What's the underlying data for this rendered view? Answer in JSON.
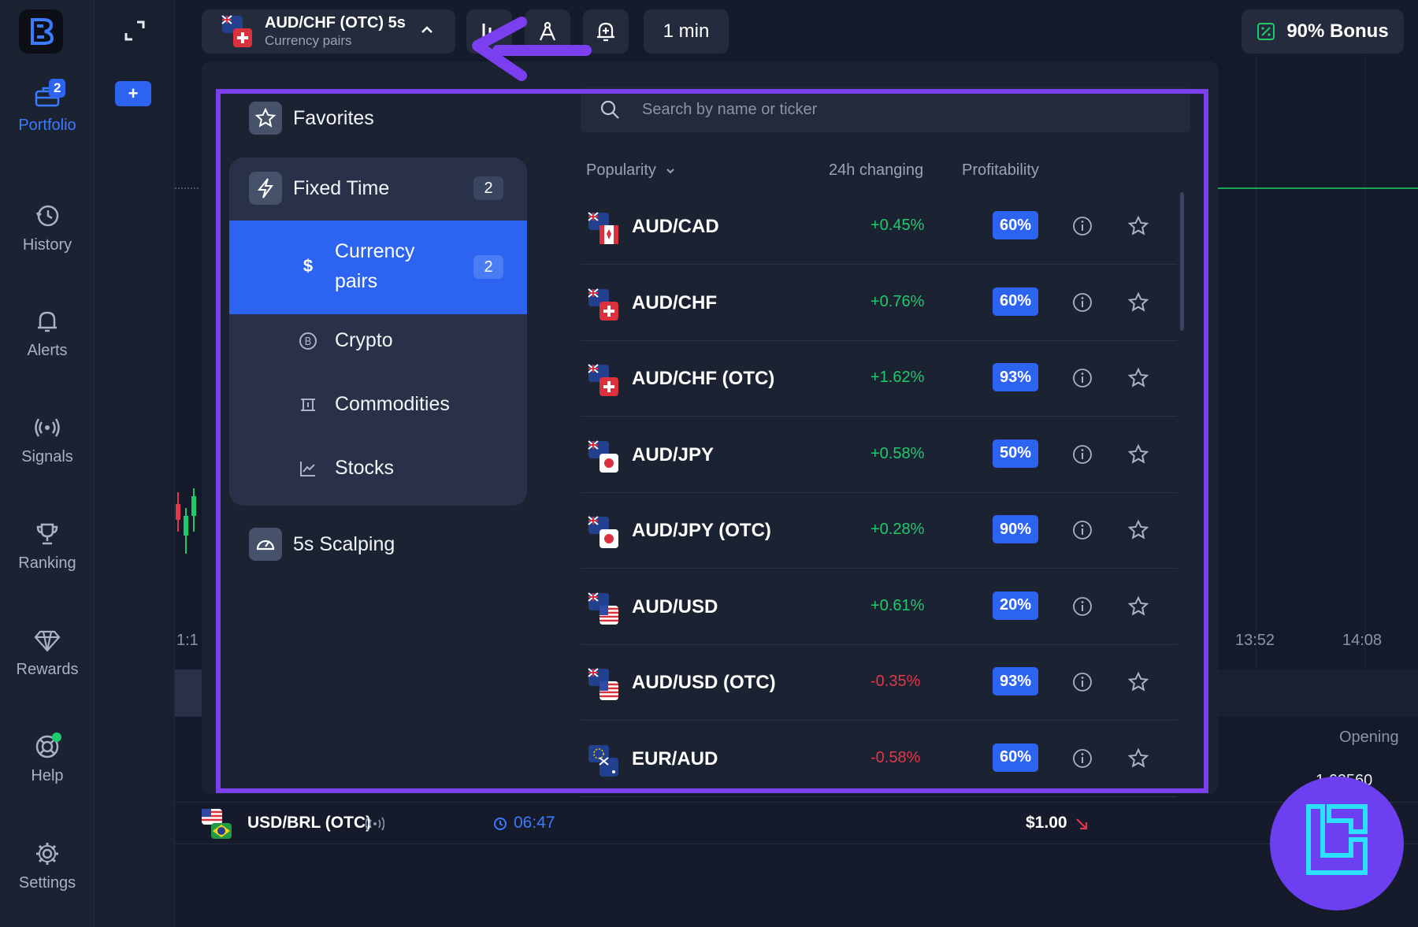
{
  "rail": {
    "items": [
      {
        "label": "Portfolio",
        "badge": "2"
      },
      {
        "label": "History"
      },
      {
        "label": "Alerts"
      },
      {
        "label": "Signals"
      },
      {
        "label": "Ranking"
      },
      {
        "label": "Rewards"
      },
      {
        "label": "Help"
      },
      {
        "label": "Settings"
      }
    ]
  },
  "col2": {
    "plus_label": "+"
  },
  "topbar": {
    "asset_name": "AUD/CHF (OTC) 5s",
    "asset_sub": "Currency pairs",
    "timeframe": "1 min",
    "bonus": "90% Bonus"
  },
  "panel": {
    "favorites": "Favorites",
    "fixed_time": "Fixed Time",
    "fixed_time_count": "2",
    "subs": [
      {
        "label": "Currency pairs",
        "count": "2"
      },
      {
        "label": "Crypto"
      },
      {
        "label": "Commodities"
      },
      {
        "label": "Stocks"
      }
    ],
    "scalping": "5s Scalping",
    "search_placeholder": "Search by name or ticker",
    "headers": {
      "popularity": "Popularity",
      "change": "24h changing",
      "profit": "Profitability"
    },
    "rows": [
      {
        "pair": "AUD/CAD",
        "change": "+0.45%",
        "profit": "60%"
      },
      {
        "pair": "AUD/CHF",
        "change": "+0.76%",
        "profit": "60%"
      },
      {
        "pair": "AUD/CHF (OTC)",
        "change": "+1.62%",
        "profit": "93%"
      },
      {
        "pair": "AUD/JPY",
        "change": "+0.58%",
        "profit": "50%"
      },
      {
        "pair": "AUD/JPY (OTC)",
        "change": "+0.28%",
        "profit": "90%"
      },
      {
        "pair": "AUD/USD",
        "change": "+0.61%",
        "profit": "20%"
      },
      {
        "pair": "AUD/USD (OTC)",
        "change": "-0.35%",
        "profit": "93%"
      },
      {
        "pair": "EUR/AUD",
        "change": "-0.58%",
        "profit": "60%"
      }
    ]
  },
  "chart": {
    "time_left": "1:1",
    "time1": "13:52",
    "time2": "14:08",
    "opening_label": "Opening",
    "opening_value": "1.62560"
  },
  "trade": {
    "pair": "USD/BRL (OTC)",
    "time": "06:47",
    "amount": "$1.00"
  },
  "colors": {
    "accent": "#2c63f0",
    "highlight": "#7b3ff0",
    "positive": "#1ecb6b",
    "negative": "#e0374b"
  }
}
